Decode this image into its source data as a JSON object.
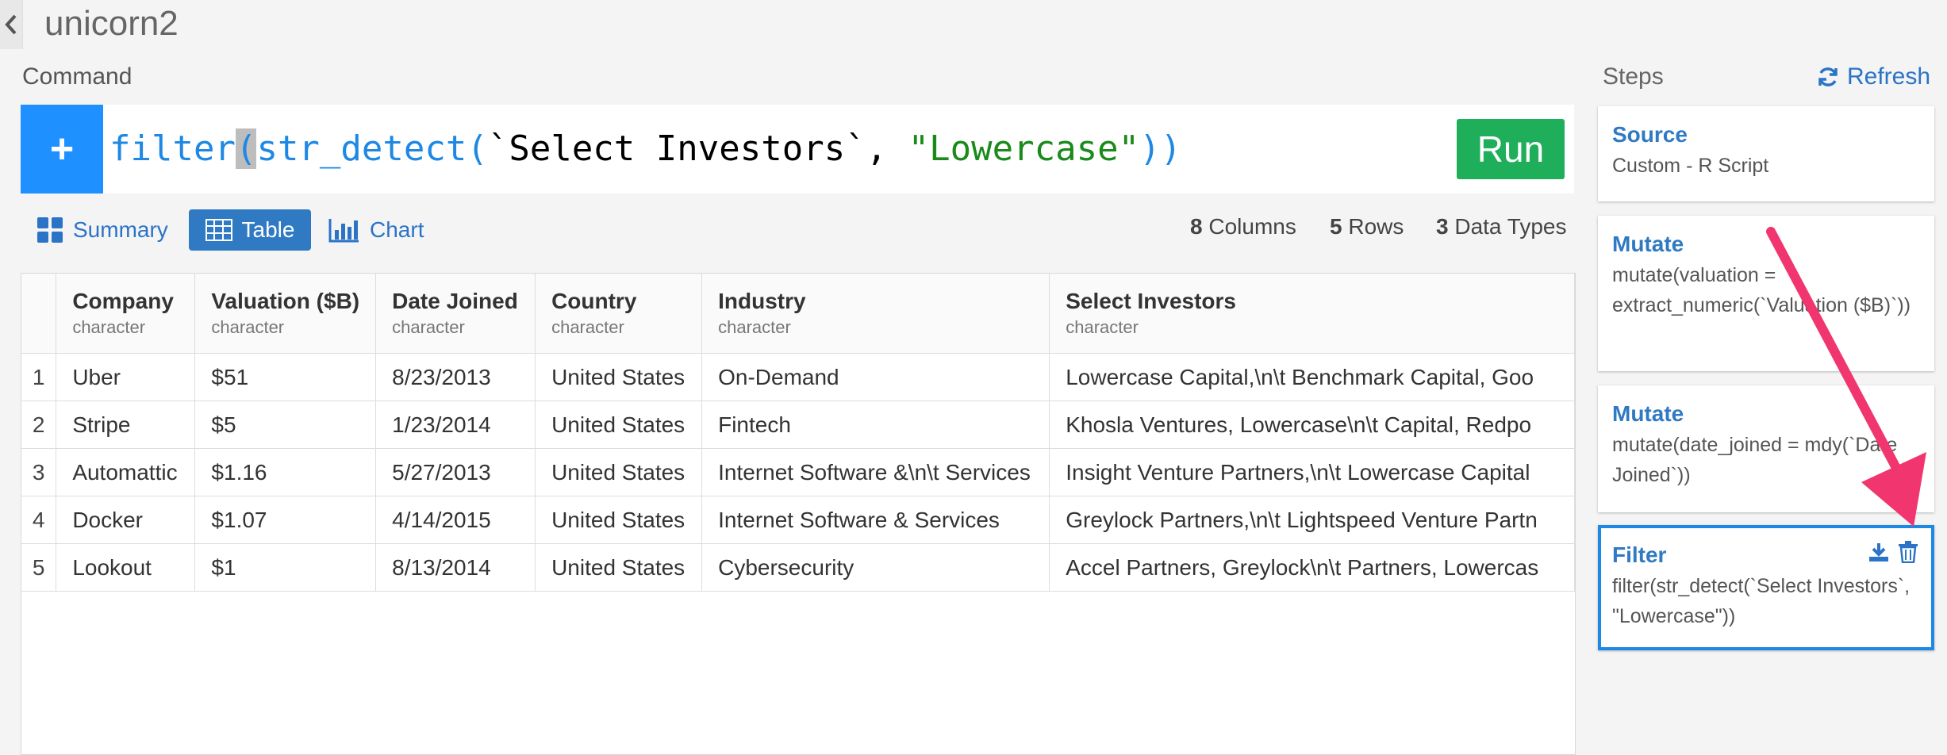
{
  "header": {
    "title": "unicorn2"
  },
  "command": {
    "label": "Command",
    "text_fn": "filter",
    "text_cursor_char": "(",
    "text_fn2": "str_detect(",
    "text_arg": "`Select Investors`, ",
    "text_str": "\"Lowercase\"",
    "text_close": "))",
    "run_label": "Run"
  },
  "view_tabs": [
    {
      "label": "Summary",
      "icon": "grid-icon"
    },
    {
      "label": "Table",
      "icon": "table-icon",
      "active": true
    },
    {
      "label": "Chart",
      "icon": "bar-chart-icon"
    }
  ],
  "stats": {
    "columns_count": "8",
    "columns_label": "Columns",
    "rows_count": "5",
    "rows_label": "Rows",
    "types_count": "3",
    "types_label": "Data Types"
  },
  "table": {
    "columns": [
      {
        "name": "Company",
        "type": "character"
      },
      {
        "name": "Valuation ($B)",
        "type": "character"
      },
      {
        "name": "Date Joined",
        "type": "character"
      },
      {
        "name": "Country",
        "type": "character"
      },
      {
        "name": "Industry",
        "type": "character"
      },
      {
        "name": "Select Investors",
        "type": "character"
      }
    ],
    "rows": [
      {
        "idx": "1",
        "cells": [
          "Uber",
          "$51",
          "8/23/2013",
          "United States",
          "On-Demand",
          "Lowercase Capital,\\n\\t  Benchmark Capital, Goo"
        ]
      },
      {
        "idx": "2",
        "cells": [
          "Stripe",
          "$5",
          "1/23/2014",
          "United States",
          "Fintech",
          "Khosla Ventures, Lowercase\\n\\t  Capital, Redpo"
        ]
      },
      {
        "idx": "3",
        "cells": [
          "Automattic",
          "$1.16",
          "5/27/2013",
          "United States",
          "Internet Software &\\n\\t  Services",
          "Insight Venture Partners,\\n\\t  Lowercase Capital"
        ]
      },
      {
        "idx": "4",
        "cells": [
          "Docker",
          "$1.07",
          "4/14/2015",
          "United States",
          "Internet Software & Services",
          "Greylock Partners,\\n\\t  Lightspeed Venture Partn"
        ]
      },
      {
        "idx": "5",
        "cells": [
          "Lookout",
          "$1",
          "8/13/2014",
          "United States",
          "Cybersecurity",
          "Accel Partners, Greylock\\n\\t  Partners, Lowercas"
        ]
      }
    ]
  },
  "steps": {
    "label": "Steps",
    "refresh_label": "Refresh",
    "items": [
      {
        "title": "Source",
        "body": "Custom - R Script"
      },
      {
        "title": "Mutate",
        "body": "mutate(valuation = extract_numeric(`Valuation ($B)`))"
      },
      {
        "title": "Mutate",
        "body": "mutate(date_joined = mdy(`Date Joined`))"
      },
      {
        "title": "Filter",
        "body": "filter(str_detect(`Select Investors`, \"Lowercase\"))"
      }
    ]
  },
  "colors": {
    "accent_blue": "#2f7ac2",
    "run_green": "#1fae5a",
    "annotation_arrow": "#f0356f"
  }
}
